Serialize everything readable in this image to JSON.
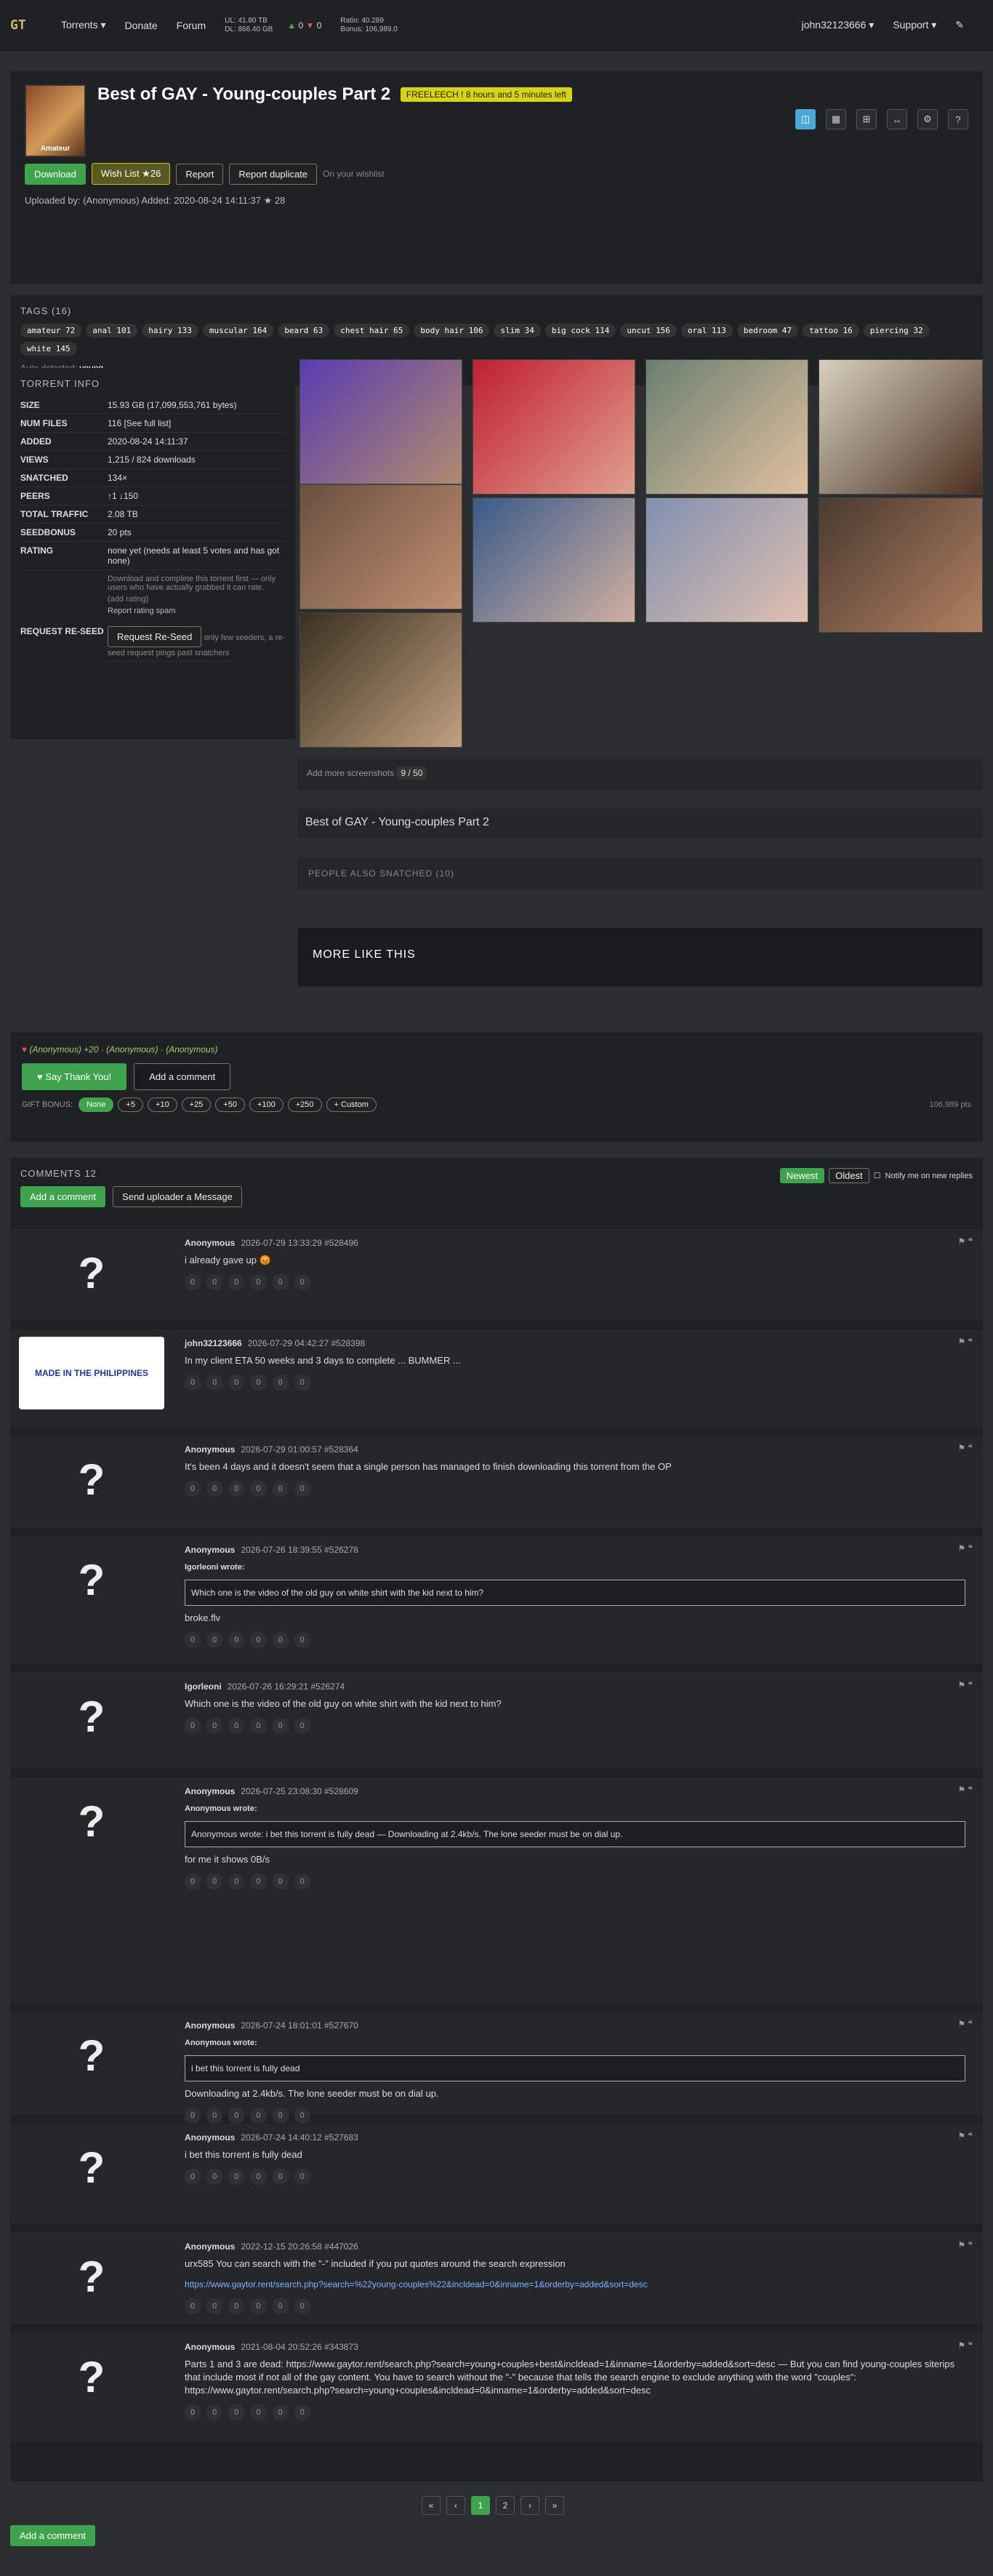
{
  "nav": {
    "logo": "GT",
    "torrents": "Torrents ▾",
    "donate": "Donate",
    "forum": "Forum",
    "ul": "UL: 41.80 TB",
    "dl": "DL: 866.40 GB",
    "seeding": "0",
    "leeching": "0",
    "ratio": "Ratio: 40.289",
    "bonus": "Bonus: 106,989.0",
    "user": "john32123666 ▾",
    "support": "Support ▾"
  },
  "torrent": {
    "title": "Best of GAY - Young-couples Part 2",
    "freeleech": "FREELEECH ! 8 hours and 5 minutes left",
    "cover_label": "Amateur",
    "download": "Download",
    "wishlist": "Wish List",
    "wish_count": "26",
    "report": "Report",
    "report_dup": "Report duplicate",
    "on_wishlist": "On your wishlist",
    "uploaded": "Uploaded by: (Anonymous)   Added: 2020-08-24 14:11:37   ★ 28"
  },
  "tags": {
    "header": "TAGS (16)",
    "list": [
      "amateur 72",
      "anal 101",
      "hairy 133",
      "muscular 164",
      "beard 63",
      "chest hair 65",
      "body hair 106",
      "slim 34",
      "big cock 114",
      "uncut 156",
      "oral 113",
      "bedroom 47",
      "tattoo 16",
      "piercing 32",
      "white 145"
    ],
    "auto": "Auto-detected:",
    "auto_tag": "young"
  },
  "info": {
    "header": "TORRENT INFO",
    "rows": [
      [
        "SIZE",
        "15.93 GB (17,099,553,761 bytes)"
      ],
      [
        "NUM FILES",
        "116 [See full list]"
      ],
      [
        "ADDED",
        "2020-08-24 14:11:37"
      ],
      [
        "VIEWS",
        "1,215 / 824 downloads"
      ],
      [
        "SNATCHED",
        "134×"
      ],
      [
        "PEERS",
        "↑1 ↓150"
      ],
      [
        "TOTAL TRAFFIC",
        "2.08 TB"
      ],
      [
        "SEEDBONUS",
        "20 pts"
      ],
      [
        "RATING",
        "none yet (needs at least 5 votes and has got none)"
      ]
    ],
    "rating_note": "Download and complete this torrent first — only users who have actually grabbed it can rate.",
    "add_rating": "(add rating)",
    "report_spam": "Report rating spam",
    "reseed_label": "REQUEST RE-SEED",
    "reseed_btn": "Request Re-Seed",
    "reseed_note": "only few seeders, a re-seed request pings past snatchers"
  },
  "screens": {
    "add": "Add more screenshots",
    "count": "9 / 50",
    "desc": "Best of GAY - Young-couples Part 2",
    "people": "PEOPLE ALSO SNATCHED (10)",
    "more": "MORE LIKE THIS"
  },
  "thanks": {
    "who": "(Anonymous) +20 · (Anonymous) · (Anonymous)",
    "say": "Say Thank You!",
    "add_comment": "Add a comment",
    "gift": "GIFT BONUS:",
    "gift_opts": [
      "None",
      "+5",
      "+10",
      "+25",
      "+50",
      "+100",
      "+250",
      "+ Custom"
    ],
    "pts": "106,989 pts"
  },
  "comments": {
    "header": "COMMENTS 12",
    "add": "Add a comment",
    "send": "Send uploader a Message",
    "newest": "Newest",
    "oldest": "Oldest",
    "notify": "Notify me on new replies",
    "bottom_add": "Add a comment"
  },
  "list": [
    {
      "user": "Anonymous",
      "meta": "2026-07-29 13:33:29 #528496",
      "text": "i already gave up 😡"
    },
    {
      "user": "john32123666",
      "meta": "2026-07-29 04:42:27 #528398",
      "text": "In my client ETA 50 weeks and 3 days to complete ... BUMMER ...",
      "banner": "MADE IN THE PHILIPPINES"
    },
    {
      "user": "Anonymous",
      "meta": "2026-07-29 01:00:57 #528364",
      "text": "It's been 4 days and it doesn't seem that a single person has managed to finish downloading this torrent from the OP"
    },
    {
      "user": "Anonymous",
      "meta": "2026-07-26 18:39:55 #526278",
      "quote_by": "Igorleoni wrote:",
      "quote": "Which one is the video of the old guy on white shirt with the kid next to him?",
      "text": "broke.flv"
    },
    {
      "user": "Igorleoni",
      "meta": "2026-07-26 16:29:21 #526274",
      "text": "Which one is the video of the old guy on white shirt with the kid next to him?"
    },
    {
      "user": "Anonymous",
      "meta": "2026-07-25 23:08:30 #528609",
      "quote_by": "Anonymous wrote:",
      "quote": "Anonymous wrote: i bet this torrent is fully dead — Downloading at 2.4kb/s. The lone seeder must be on dial up.",
      "text": "for me it shows 0B/s"
    },
    {
      "user": "Anonymous",
      "meta": "2026-07-24 18:01:01 #527670",
      "quote_by": "Anonymous wrote:",
      "quote": "i bet this torrent is fully dead",
      "text": "Downloading at 2.4kb/s. The lone seeder must be on dial up."
    },
    {
      "user": "Anonymous",
      "meta": "2026-07-24 14:40:12 #527683",
      "text": "i bet this torrent is fully dead"
    },
    {
      "user": "Anonymous",
      "meta": "2022-12-15 20:26:58 #447026",
      "text": "urx585 You can search with the \"-\" included if you put quotes around the search expression",
      "link": "https://www.gaytor.rent/search.php?search=%22young-couples%22&incldead=0&inname=1&orderby=added&sort=desc"
    },
    {
      "user": "Anonymous",
      "meta": "2021-08-04 20:52:26 #343873",
      "text": "Parts 1 and 3 are dead: https://www.gaytor.rent/search.php?search=young+couples+best&incldead=1&inname=1&orderby=added&sort=desc — But you can find young-couples siterips that include most if not all of the gay content. You have to search without the \"-\" because that tells the search engine to exclude anything with the word \"couples\": https://www.gaytor.rent/search.php?search=young+couples&incldead=0&inname=1&orderby=added&sort=desc"
    }
  ],
  "pager": [
    "«",
    "‹",
    "1",
    "2",
    "›",
    "»"
  ],
  "reacts": [
    "0",
    "0",
    "0",
    "0",
    "0",
    "0"
  ]
}
